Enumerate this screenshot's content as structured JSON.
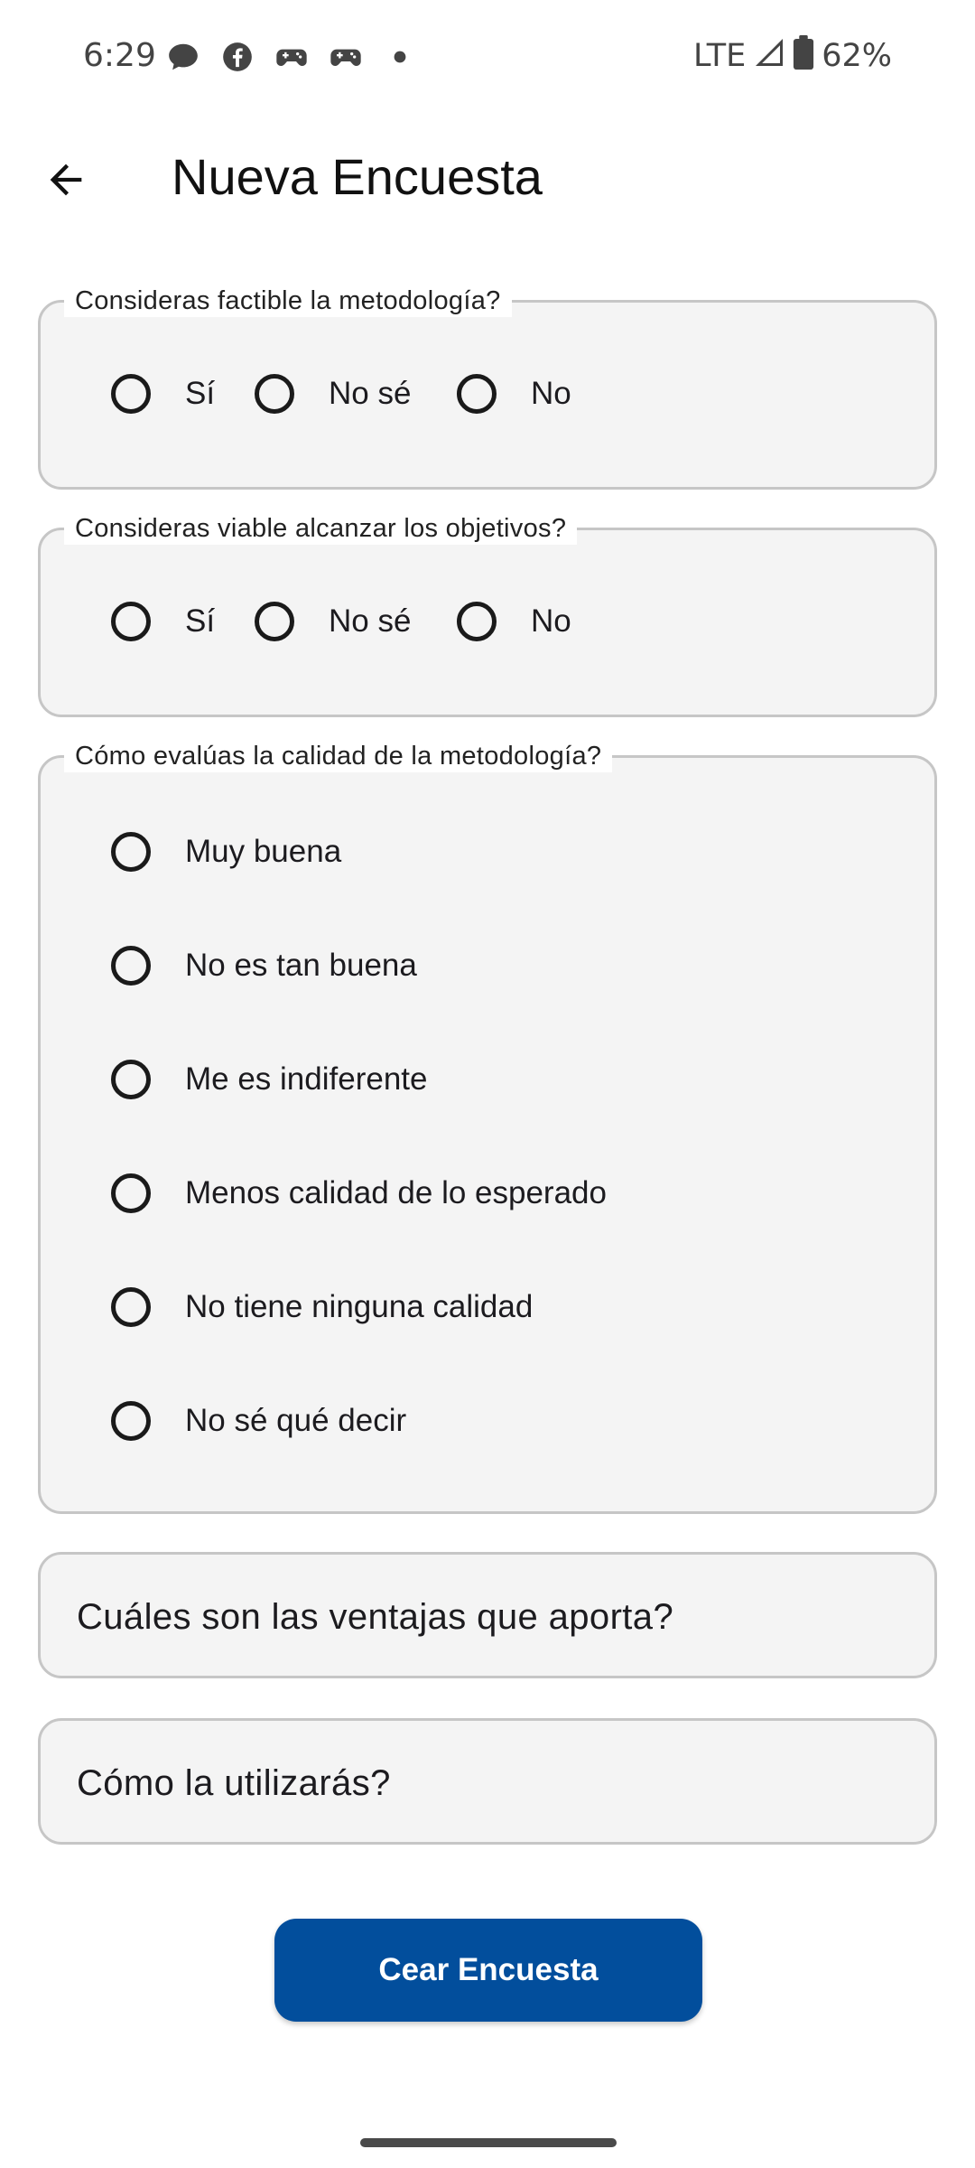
{
  "status_bar": {
    "time": "6:29",
    "network": "LTE",
    "battery": "62%",
    "left_icons": [
      "chat-bubble-icon",
      "facebook-icon",
      "game-controller-icon",
      "game-controller-icon",
      "more-dot-icon"
    ],
    "right_icons": [
      "signal-icon",
      "battery-icon"
    ]
  },
  "app_bar": {
    "title": "Nueva Encuesta",
    "back_icon": "arrow-back-icon"
  },
  "questions": [
    {
      "label": "Consideras factible la metodología?",
      "options": [
        "Sí",
        "No sé",
        "No"
      ]
    },
    {
      "label": "Consideras viable alcanzar los objetivos?",
      "options": [
        "Sí",
        "No sé",
        "No"
      ]
    },
    {
      "label": "Cómo evalúas la calidad de la metodología?",
      "options": [
        "Muy buena",
        "No es tan buena",
        "Me es indiferente",
        "Menos calidad de lo esperado",
        "No tiene ninguna calidad",
        "No sé qué decir"
      ]
    }
  ],
  "text_fields": [
    {
      "placeholder": "Cuáles son las ventajas que aporta?"
    },
    {
      "placeholder": "Cómo la utilizarás?"
    }
  ],
  "submit_button": {
    "label": "Cear Encuesta"
  },
  "colors": {
    "primary": "#024e9c",
    "field_background": "#f4f4f4",
    "field_border": "#c6c6c6"
  }
}
